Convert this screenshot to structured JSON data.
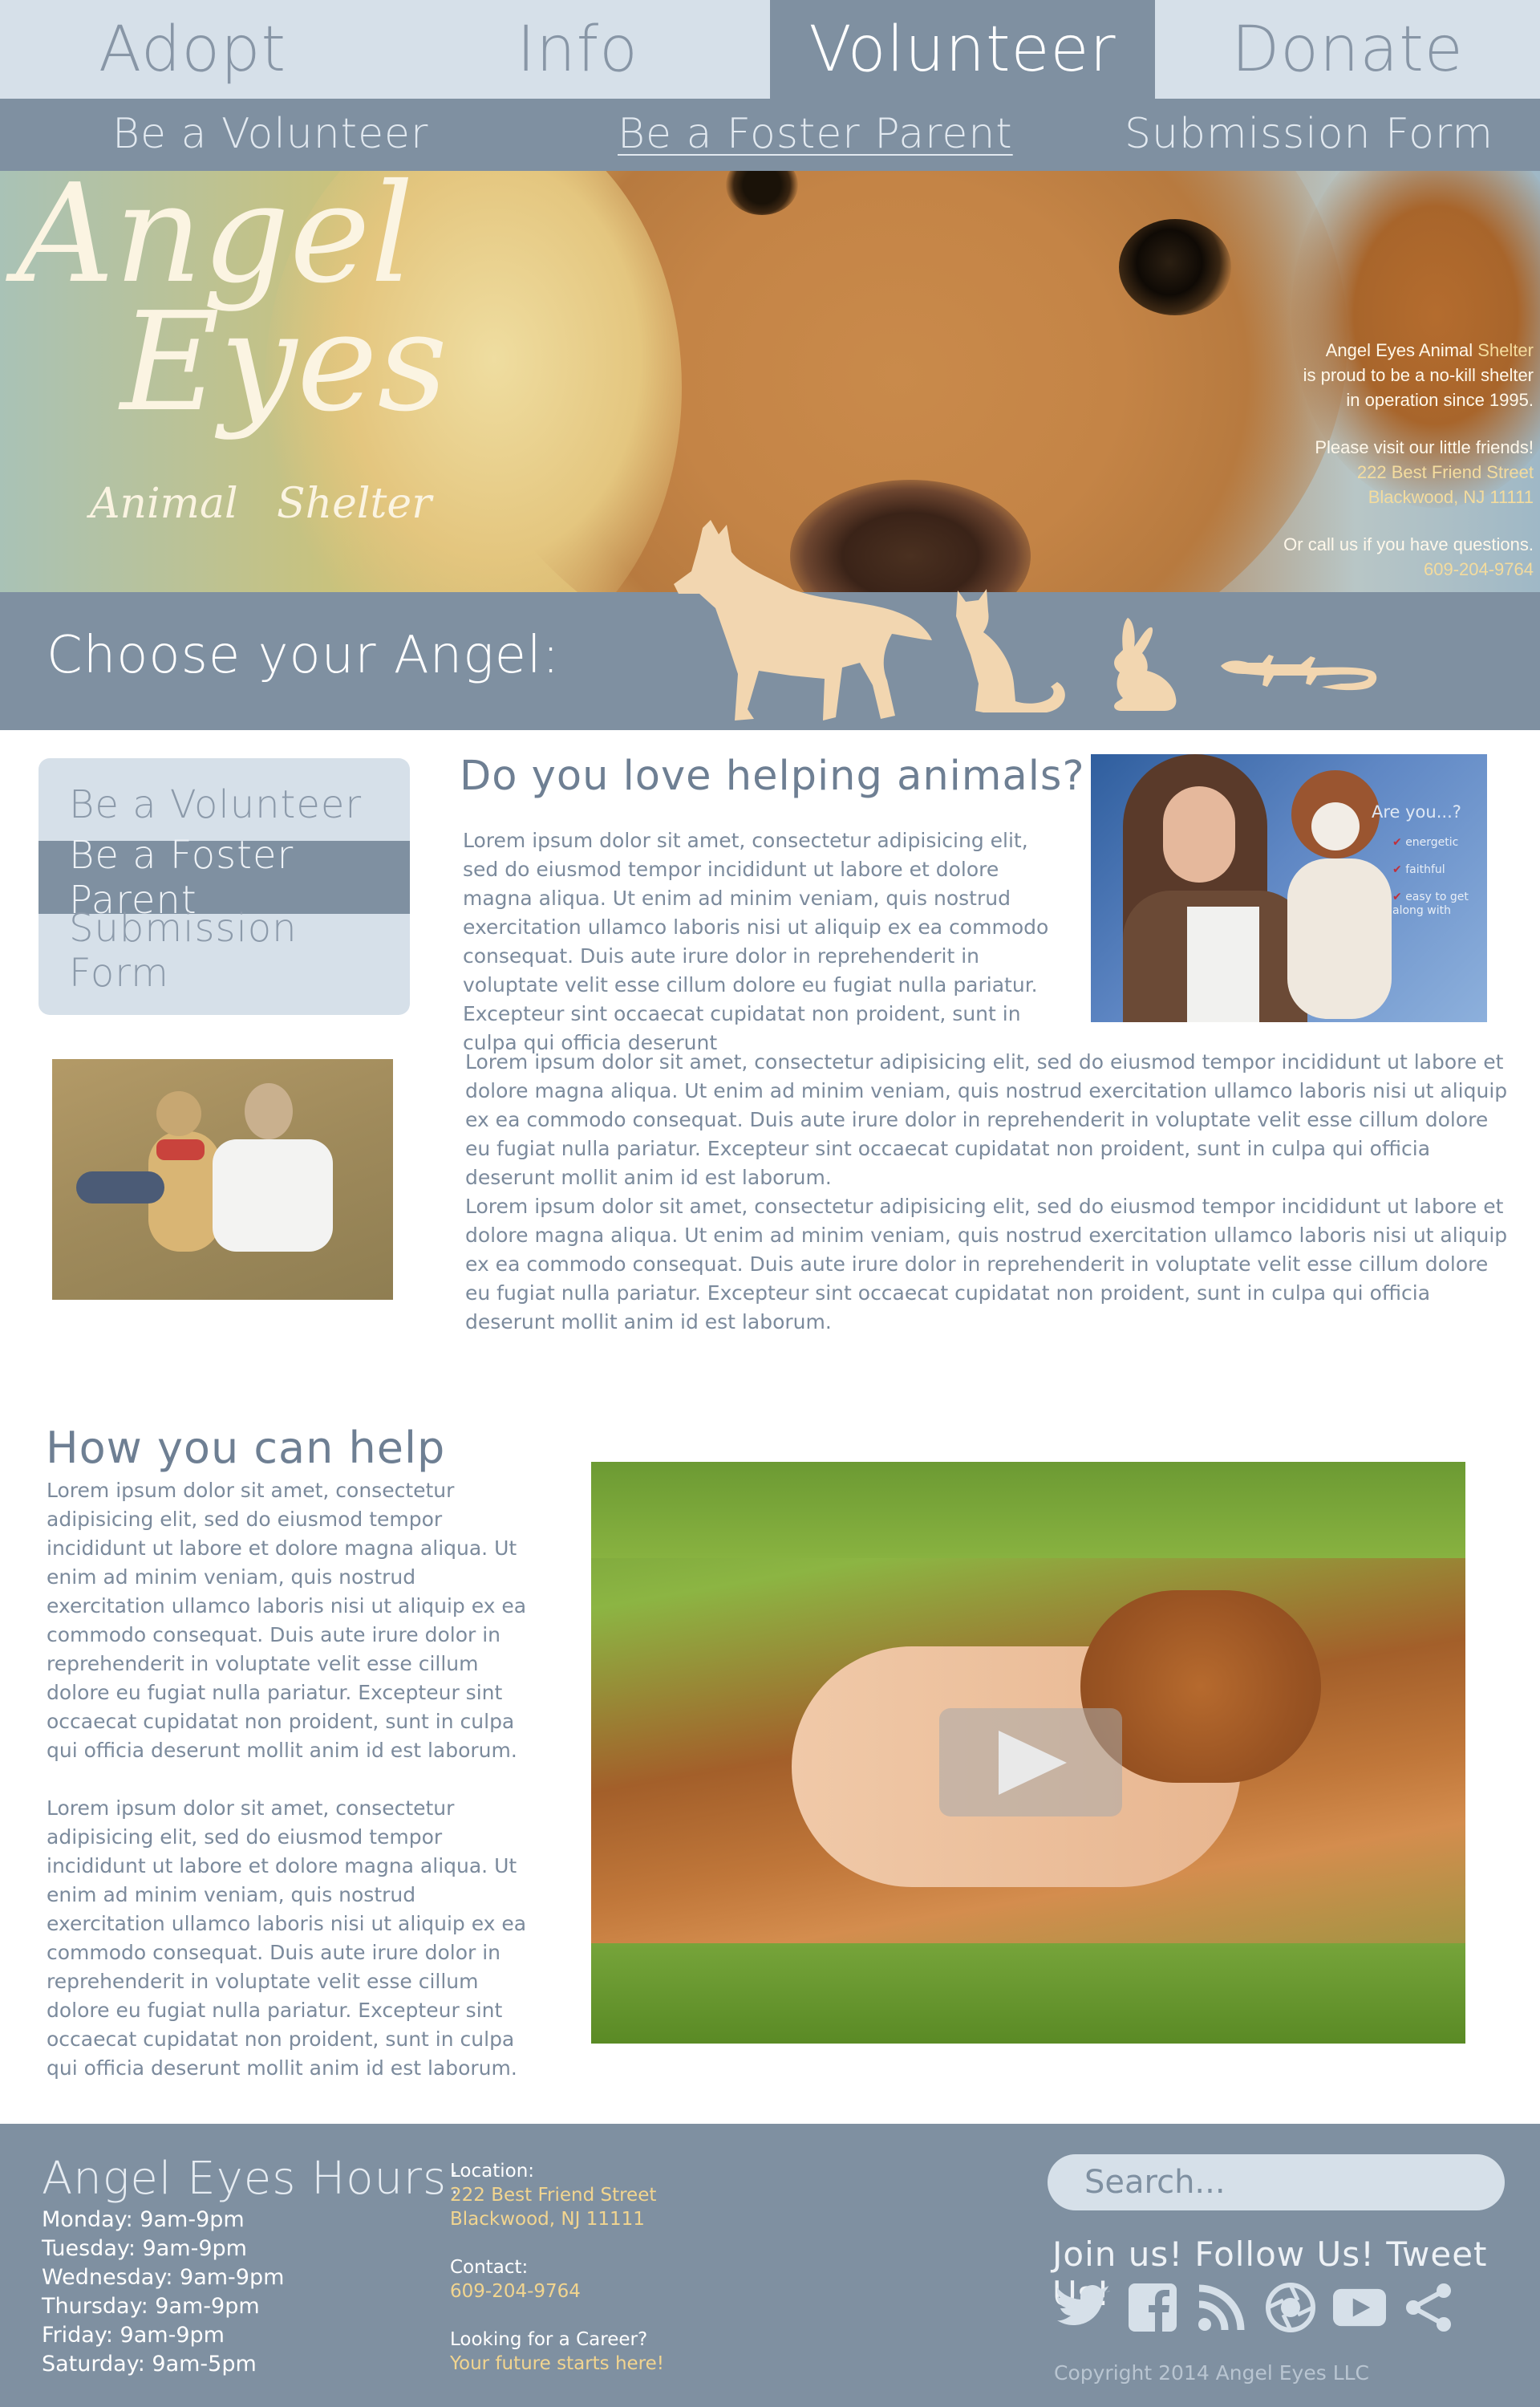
{
  "top_nav": {
    "tabs": [
      {
        "label": "Adopt"
      },
      {
        "label": "Info"
      },
      {
        "label": "Volunteer"
      },
      {
        "label": "Donate"
      }
    ]
  },
  "sub_nav": {
    "items": [
      {
        "label": "Be a Volunteer"
      },
      {
        "label": "Be a Foster Parent"
      },
      {
        "label": "Submission Form"
      }
    ]
  },
  "hero": {
    "logo": {
      "line1": "Angel",
      "line2": "Eyes",
      "sub1": "Animal",
      "sub2": "Shelter"
    },
    "info": {
      "l1a": "Angel Eyes Animal",
      "l1b": "Shelter",
      "l2": "is proud to be a no-kill shelter",
      "l3": "in operation since 1995.",
      "l4": "Please visit our little friends!",
      "l5": "222 Best Friend Street",
      "l6": "Blackwood, NJ 11111",
      "l7": "Or call us if you have questions.",
      "l8": "609-204-9764"
    }
  },
  "choose": {
    "label": "Choose your Angel:",
    "animals": [
      "dog-icon",
      "cat-icon",
      "rabbit-icon",
      "lizard-icon"
    ]
  },
  "side_menu": {
    "items": [
      {
        "label": "Be a Volunteer"
      },
      {
        "label": "Be a Foster Parent"
      },
      {
        "label": "Submission Form"
      }
    ]
  },
  "intro": {
    "heading": "Do you love helping animals?",
    "paragraph1": "Lorem ipsum dolor sit amet, consectetur adipisicing elit, sed do eiusmod tempor incididunt ut labore et dolore magna aliqua. Ut enim ad minim veniam, quis nostrud exercitation ullamco laboris nisi ut aliquip ex ea commodo consequat. Duis aute irure dolor in reprehenderit in voluptate velit esse cillum dolore eu fugiat nulla pariatur. Excepteur sint occaecat cupidatat non proident, sunt in culpa qui officia deserunt",
    "paragraph2": "Lorem ipsum dolor sit amet, consectetur adipisicing elit, sed do eiusmod tempor incididunt ut labore et dolore magna aliqua. Ut enim ad minim veniam, quis nostrud exercitation ullamco laboris nisi ut aliquip ex ea commodo consequat. Duis aute irure dolor in reprehenderit in voluptate velit esse cillum dolore eu fugiat nulla pariatur. Excepteur sint occaecat cupidatat non proident, sunt in culpa qui officia deserunt mollit anim id est laborum.",
    "paragraph3": "Lorem ipsum dolor sit amet, consectetur adipisicing elit, sed do eiusmod tempor incididunt ut labore et dolore magna aliqua. Ut enim ad minim veniam, quis nostrud exercitation ullamco laboris nisi ut aliquip ex ea commodo consequat. Duis aute irure dolor in reprehenderit in voluptate velit esse cillum dolore eu fugiat nulla pariatur. Excepteur sint occaecat cupidatat non proident, sunt in culpa qui officia deserunt mollit anim id est laborum.",
    "photo_card": {
      "title": "Are you...?",
      "items": [
        "energetic",
        "faithful",
        "easy to get along with"
      ]
    }
  },
  "help": {
    "heading": "How you can help",
    "paragraph1": "Lorem ipsum dolor sit amet, consectetur adipisicing elit, sed do eiusmod tempor incididunt ut labore et dolore magna aliqua. Ut enim ad minim veniam, quis nostrud exercitation ullamco laboris nisi ut aliquip ex ea commodo consequat. Duis aute irure dolor in reprehenderit in voluptate velit esse cillum dolore eu fugiat nulla pariatur. Excepteur sint occaecat cupidatat non proident, sunt in culpa qui officia deserunt mollit anim id est laborum.",
    "paragraph2": "Lorem ipsum dolor sit amet, consectetur adipisicing elit, sed do eiusmod tempor incididunt ut labore et dolore magna aliqua. Ut enim ad minim veniam, quis nostrud exercitation ullamco laboris nisi ut aliquip ex ea commodo consequat. Duis aute irure dolor in reprehenderit in voluptate velit esse cillum dolore eu fugiat nulla pariatur. Excepteur sint occaecat cupidatat non proident, sunt in culpa qui officia deserunt mollit anim id est laborum."
  },
  "footer": {
    "hours_title": "Angel Eyes Hours:",
    "hours": [
      "Monday: 9am-9pm",
      "Tuesday: 9am-9pm",
      "Wednesday: 9am-9pm",
      "Thursday: 9am-9pm",
      "Friday: 9am-9pm",
      "Saturday: 9am-5pm"
    ],
    "location_label": "Location:",
    "location_line1": "222 Best Friend Street",
    "location_line2": "Blackwood, NJ 11111",
    "contact_label": "Contact:",
    "contact_phone": "609-204-9764",
    "career_label": "Looking for a Career?",
    "career_link": "Your future starts here!",
    "search_placeholder": "Search...",
    "follow": "Join us! Follow Us! Tweet Us!",
    "social": [
      "twitter-icon",
      "facebook-icon",
      "rss-icon",
      "camera-aperture-icon",
      "youtube-icon",
      "share-icon"
    ],
    "copyright": "Copyright 2014 Angel Eyes LLC"
  },
  "colors": {
    "slate": "#7f90a1",
    "light": "#d6e0e9",
    "accent": "#f2d58f",
    "text": "#6e7f93"
  }
}
